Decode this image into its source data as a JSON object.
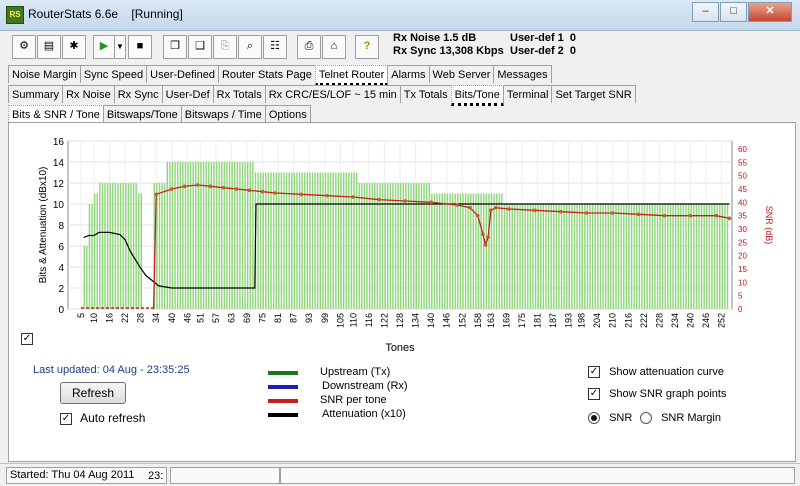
{
  "window": {
    "title": "RouterStats 6.6e",
    "state": "[Running]",
    "icon_text": "RS"
  },
  "stats": {
    "noise_label": "Rx Noise",
    "noise_value": "1.5 dB",
    "sync_label": "Rx Sync",
    "sync_value": "13,308 Kbps",
    "userdef1_label": "User-def 1",
    "userdef1_value": "0",
    "userdef2_label": "User-def 2",
    "userdef2_value": "0"
  },
  "toolbar_icons": [
    "connect-icon",
    "save-icon",
    "bug-icon",
    "play-icon",
    "dropdown-icon",
    "stop-icon",
    "copy-icon",
    "copy-window-icon",
    "paste-icon",
    "zoom-icon",
    "preview-icon",
    "print-icon",
    "home-icon",
    "help-icon"
  ],
  "tabs_row1": [
    "Noise Margin",
    "Sync Speed",
    "User-Defined",
    "Router Stats Page",
    "Telnet Router",
    "Alarms",
    "Web Server",
    "Messages"
  ],
  "tabs_row2": [
    "Summary",
    "Rx Noise",
    "Rx Sync",
    "User-Def",
    "Rx  Totals",
    "Rx CRC/ES/LOF ~ 15 min",
    "Tx  Totals",
    "Bits/Tone",
    "Terminal",
    "Set Target SNR"
  ],
  "tabs_row3": [
    "Bits & SNR / Tone",
    "Bitswaps/Tone",
    "Bitswaps / Time",
    "Options"
  ],
  "chart_data": {
    "type": "bar",
    "title": "",
    "xlabel": "Tones",
    "ylabel": "Bits & Attenuation (dBx10)",
    "y2label": "SNR (dB)",
    "ylim": [
      0,
      16
    ],
    "y2lim": [
      0,
      63
    ],
    "yticks": [
      "0",
      "2",
      "4",
      "6",
      "8",
      "10",
      "12",
      "14",
      "16"
    ],
    "y2ticks": [
      "0",
      "5",
      "10",
      "15",
      "20",
      "25",
      "30",
      "35",
      "40",
      "45",
      "50",
      "55",
      "60"
    ],
    "xticks": [
      "5",
      "10",
      "16",
      "22",
      "28",
      "34",
      "40",
      "46",
      "51",
      "57",
      "63",
      "69",
      "75",
      "81",
      "87",
      "93",
      "99",
      "105",
      "110",
      "116",
      "122",
      "128",
      "134",
      "140",
      "146",
      "152",
      "158",
      "163",
      "169",
      "175",
      "181",
      "187",
      "193",
      "198",
      "204",
      "210",
      "216",
      "222",
      "228",
      "234",
      "240",
      "246",
      "252"
    ],
    "grid": true,
    "series": [
      {
        "name": "Upstream (Tx)",
        "color": "#1a7a1a",
        "segments": [
          {
            "from": 6,
            "to": 8,
            "bits": 6
          },
          {
            "from": 8,
            "to": 10,
            "bits": 10
          },
          {
            "from": 10,
            "to": 12,
            "bits": 11
          },
          {
            "from": 12,
            "to": 27,
            "bits": 12
          },
          {
            "from": 27,
            "to": 29,
            "bits": 11
          },
          {
            "from": 33,
            "to": 38,
            "bits": 12
          },
          {
            "from": 38,
            "to": 72,
            "bits": 14
          },
          {
            "from": 72,
            "to": 75,
            "bits": 13
          },
          {
            "from": 75,
            "to": 112,
            "bits": 13
          },
          {
            "from": 112,
            "to": 140,
            "bits": 12
          },
          {
            "from": 140,
            "to": 168,
            "bits": 11
          },
          {
            "from": 168,
            "to": 200,
            "bits": 10
          },
          {
            "from": 200,
            "to": 255,
            "bits": 10
          }
        ]
      },
      {
        "name": "Downstream (Rx)",
        "color": "#1c1cb8"
      },
      {
        "name": "SNR per tone",
        "color": "#c81e1e",
        "points_tone": [
          33,
          34,
          40,
          45,
          50,
          55,
          60,
          65,
          70,
          75,
          80,
          90,
          100,
          110,
          120,
          130,
          140,
          150,
          155,
          158,
          160,
          161,
          162,
          163,
          165,
          170,
          180,
          190,
          200,
          210,
          220,
          230,
          240,
          250,
          255
        ],
        "points_snr": [
          0,
          43,
          45,
          46,
          46.5,
          46,
          45.5,
          45,
          44.5,
          44,
          43.5,
          43,
          42.5,
          42,
          41,
          40.5,
          40,
          39,
          38,
          35,
          28,
          24,
          27,
          37,
          38,
          37.5,
          37,
          36.5,
          36,
          36,
          35.5,
          35,
          35,
          35,
          34
        ]
      },
      {
        "name": "Attenuation (x10)",
        "color": "#000000",
        "points_tone": [
          6,
          8,
          10,
          12,
          16,
          20,
          22,
          24,
          26,
          28,
          30,
          35,
          40,
          45,
          50,
          55,
          60,
          65,
          70,
          72,
          72.5,
          80,
          100,
          120,
          140,
          160,
          180,
          200,
          220,
          240,
          255
        ],
        "points_att": [
          6.8,
          7,
          7,
          7.3,
          7.3,
          7.1,
          6.6,
          5.5,
          4.7,
          3.9,
          3.2,
          2.2,
          2,
          2,
          2,
          2,
          2,
          2,
          2,
          2,
          10,
          10,
          10,
          10,
          10,
          10,
          10,
          10,
          10,
          10,
          10
        ]
      }
    ]
  },
  "controls": {
    "last_updated": "Last updated: 04 Aug - 23:35:25",
    "refresh": "Refresh",
    "auto_refresh": "Auto refresh",
    "legend": [
      "Upstream (Tx)",
      "Downstream (Rx)",
      "SNR per tone",
      "Attenuation (x10)"
    ],
    "show_attenuation": "Show attenuation curve",
    "show_snr_points": "Show SNR graph points",
    "snr": "SNR",
    "snr_margin": "SNR Margin",
    "check_mark": "✓"
  },
  "statusbar": {
    "started": "Started: Thu 04 Aug 2011",
    "time": "23:"
  }
}
